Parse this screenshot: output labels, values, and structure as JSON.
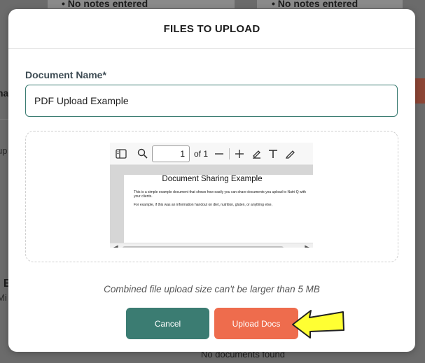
{
  "background": {
    "notes_left": "• No notes entered",
    "notes_right": "• No notes entered",
    "left_fragments": [
      "na",
      "up",
      "l E",
      "Mi"
    ],
    "bottom_text": "No documents found"
  },
  "modal": {
    "title": "FILES TO UPLOAD",
    "document_name_label": "Document Name*",
    "document_name_value": "PDF Upload Example",
    "size_note": "Combined file upload size can't be larger than 5 MB",
    "cancel_label": "Cancel",
    "upload_label": "Upload Docs"
  },
  "pdf_viewer": {
    "page_number": "1",
    "page_count_label": "of 1",
    "doc_title": "Document Sharing Example",
    "paragraph_1": "This is a simple example document that shows how easily you can share documents you upload to Nutri-Q with your clients.",
    "paragraph_2": "For example, if this was an information handout on diet, nutrition, gluten, or anything else,"
  },
  "colors": {
    "primary_teal": "#3b7c72",
    "accent_orange": "#ee6c4d",
    "arrow_yellow": "#ffff33"
  }
}
